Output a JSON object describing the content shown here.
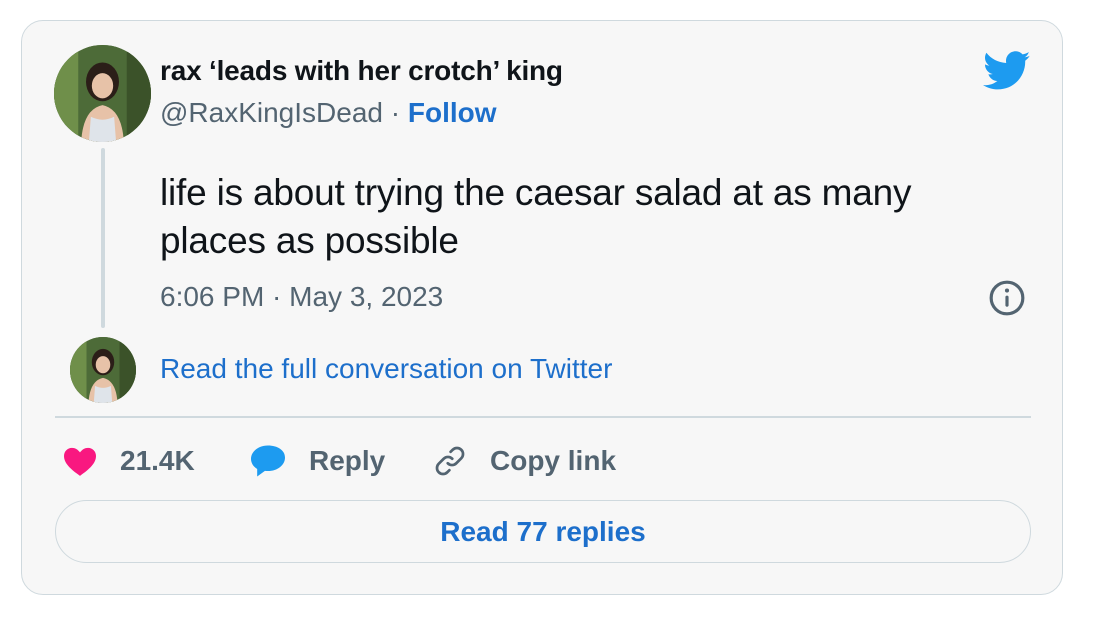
{
  "author": {
    "display_name": "rax ‘leads with her crotch’ king",
    "handle": "@RaxKingIsDead",
    "separator": " · ",
    "follow_label": "Follow"
  },
  "tweet": {
    "text": "life is about trying the caesar salad at as many places as possible",
    "timestamp": "6:06 PM · May 3, 2023"
  },
  "conversation": {
    "link_label": "Read the full conversation on Twitter"
  },
  "actions": {
    "like_count": "21.4K",
    "reply_label": "Reply",
    "copy_label": "Copy link"
  },
  "replies_button": {
    "label": "Read 77 replies"
  },
  "icons": {
    "brand": "twitter-bird-icon",
    "info": "info-icon",
    "like": "heart-icon",
    "reply": "speech-bubble-icon",
    "copy": "link-icon"
  },
  "colors": {
    "link_blue": "#1d6fcb",
    "twitter_blue": "#1d9bf0",
    "heart_pink": "#f91880",
    "muted_text": "#536471",
    "border": "#cfd9de",
    "card_bg": "#f7f7f7"
  }
}
